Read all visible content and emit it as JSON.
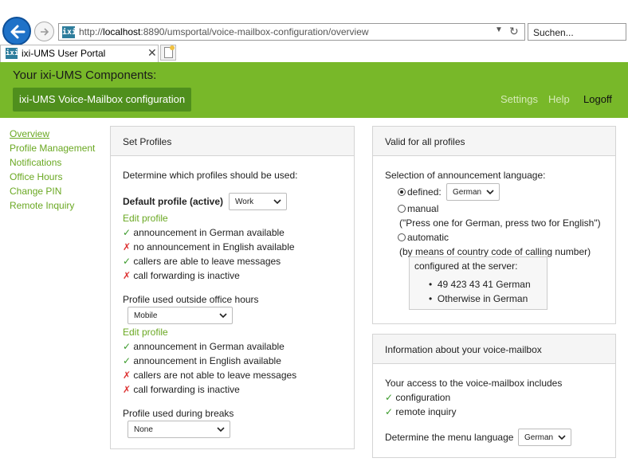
{
  "browser": {
    "url_prefix": "http://",
    "url_host": "localhost",
    "url_rest": ":8890/umsportal/voice-mailbox-configuration/overview",
    "search_placeholder": "Suchen...",
    "tab_label": "ixi-UMS User Portal",
    "favicon_text": "ixi"
  },
  "header": {
    "title": "Your ixi-UMS Components:",
    "component_button": "ixi-UMS Voice-Mailbox configuration",
    "nav": {
      "settings": "Settings",
      "help": "Help",
      "logoff": "Logoff"
    }
  },
  "sidebar": [
    "Overview",
    "Profile Management",
    "Notifications",
    "Office Hours",
    "Change PIN",
    "Remote Inquiry"
  ],
  "set_profiles": {
    "title": "Set Profiles",
    "intro": "Determine which profiles should be used:",
    "default_label": "Default profile (active)",
    "default_value": "Work",
    "edit1": "Edit profile",
    "default_status": [
      {
        "ok": true,
        "text": "announcement in German available"
      },
      {
        "ok": false,
        "text": "no announcement in English available"
      },
      {
        "ok": true,
        "text": "callers are able to leave messages"
      },
      {
        "ok": false,
        "text": "call forwarding is inactive"
      }
    ],
    "outside_label": "Profile used outside office hours",
    "outside_value": "Mobile",
    "edit2": "Edit profile",
    "outside_status": [
      {
        "ok": true,
        "text": "announcement in German available"
      },
      {
        "ok": true,
        "text": "announcement in English available"
      },
      {
        "ok": false,
        "text": "callers are not able to leave messages"
      },
      {
        "ok": false,
        "text": "call forwarding is inactive"
      }
    ],
    "breaks_label": "Profile used during breaks",
    "breaks_value": "None",
    "check_mark": "✓",
    "cross_mark": "✗"
  },
  "valid_all": {
    "title": "Valid for all profiles",
    "selection_label": "Selection of announcement language:",
    "defined_label": "defined:",
    "defined_value": "German",
    "manual_label": "manual",
    "manual_hint": "(\"Press one for German, press two for English\")",
    "automatic_label": "automatic",
    "automatic_hint": "(by means of country code of calling number)",
    "server_title": "configured at the server:",
    "server_items": [
      "49  423  43  41  German",
      "Otherwise in German"
    ],
    "selected_option": "defined"
  },
  "info": {
    "title": "Information about your voice-mailbox",
    "access_label": "Your access to the voice-mailbox includes",
    "items": [
      "configuration",
      "remote inquiry"
    ],
    "menu_lang_label": "Determine the menu language",
    "menu_lang_value": "German"
  },
  "colors": {
    "brand_green": "#78b829",
    "link_green": "#6aa822",
    "button_green": "#4f8f1d",
    "ok": "#3a9a2a",
    "bad": "#dd3333"
  }
}
